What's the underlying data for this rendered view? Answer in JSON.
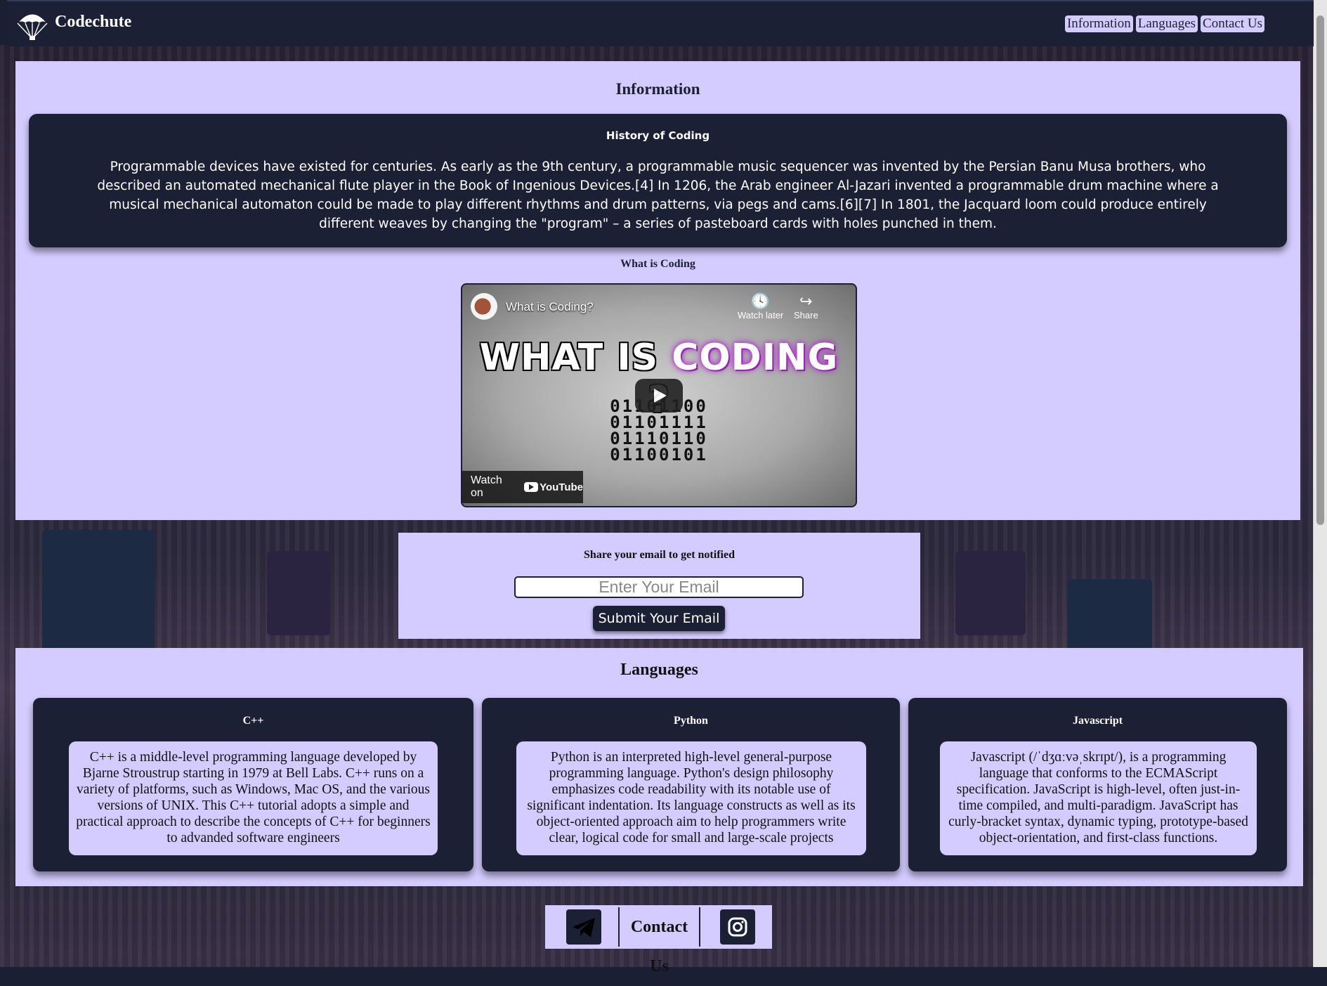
{
  "header": {
    "brand": "Codechute",
    "nav": [
      "Information",
      "Languages",
      "Contact Us"
    ]
  },
  "information": {
    "title": "Information",
    "history": {
      "title": "History of Coding",
      "text": "Programmable devices have existed for centuries. As early as the 9th century, a programmable music sequencer was invented by the Persian Banu Musa brothers, who described an automated mechanical flute player in the Book of Ingenious Devices.[4] In 1206, the Arab engineer Al-Jazari invented a programmable drum machine where a musical mechanical automaton could be made to play different rhythms and drum patterns, via pegs and cams.[6][7] In 1801, the Jacquard loom could produce entirely different weaves by changing the \"program\" – a series of pasteboard cards with holes punched in them."
    },
    "video_heading": "What is Coding",
    "video": {
      "title": "What is Coding?",
      "watch_later": "Watch later",
      "share": "Share",
      "thumb_text_a": "WHAT IS ",
      "thumb_text_b": "CODING",
      "thumb_text_c": " ?",
      "binary": [
        "01101100",
        "01101111",
        "01110110",
        "01100101"
      ],
      "watch_on": "Watch on",
      "youtube": "YouTube"
    }
  },
  "notify": {
    "heading": "Share your email to get notified",
    "placeholder": "Enter Your Email",
    "button": "Submit Your Email"
  },
  "languages": {
    "title": "Languages",
    "cards": [
      {
        "name": "C++",
        "text": "C++ is a middle-level programming language developed by Bjarne Stroustrup starting in 1979 at Bell Labs. C++ runs on a variety of platforms, such as Windows, Mac OS, and the various versions of UNIX. This C++ tutorial adopts a simple and practical approach to describe the concepts of C++ for beginners to advanded software engineers"
      },
      {
        "name": "Python",
        "text": "Python is an interpreted high-level general-purpose programming language. Python's design philosophy emphasizes code readability with its notable use of significant indentation. Its language constructs as well as its object-oriented approach aim to help programmers write clear, logical code for small and large-scale projects"
      },
      {
        "name": "Javascript",
        "text": "Javascript (/ˈdʒɑːvəˌskrɪpt/), is a programming language that conforms to the ECMAScript specification. JavaScript is high-level, often just-in-time compiled, and multi-paradigm. JavaScript has curly-bracket syntax, dynamic typing, prototype-based object-orientation, and first-class functions."
      }
    ]
  },
  "footer": {
    "title": "Contact Us",
    "icons": [
      "telegram-icon",
      "instagram-icon"
    ]
  },
  "colors": {
    "navy": "#1c2035",
    "lavender": "#d4ccff"
  }
}
